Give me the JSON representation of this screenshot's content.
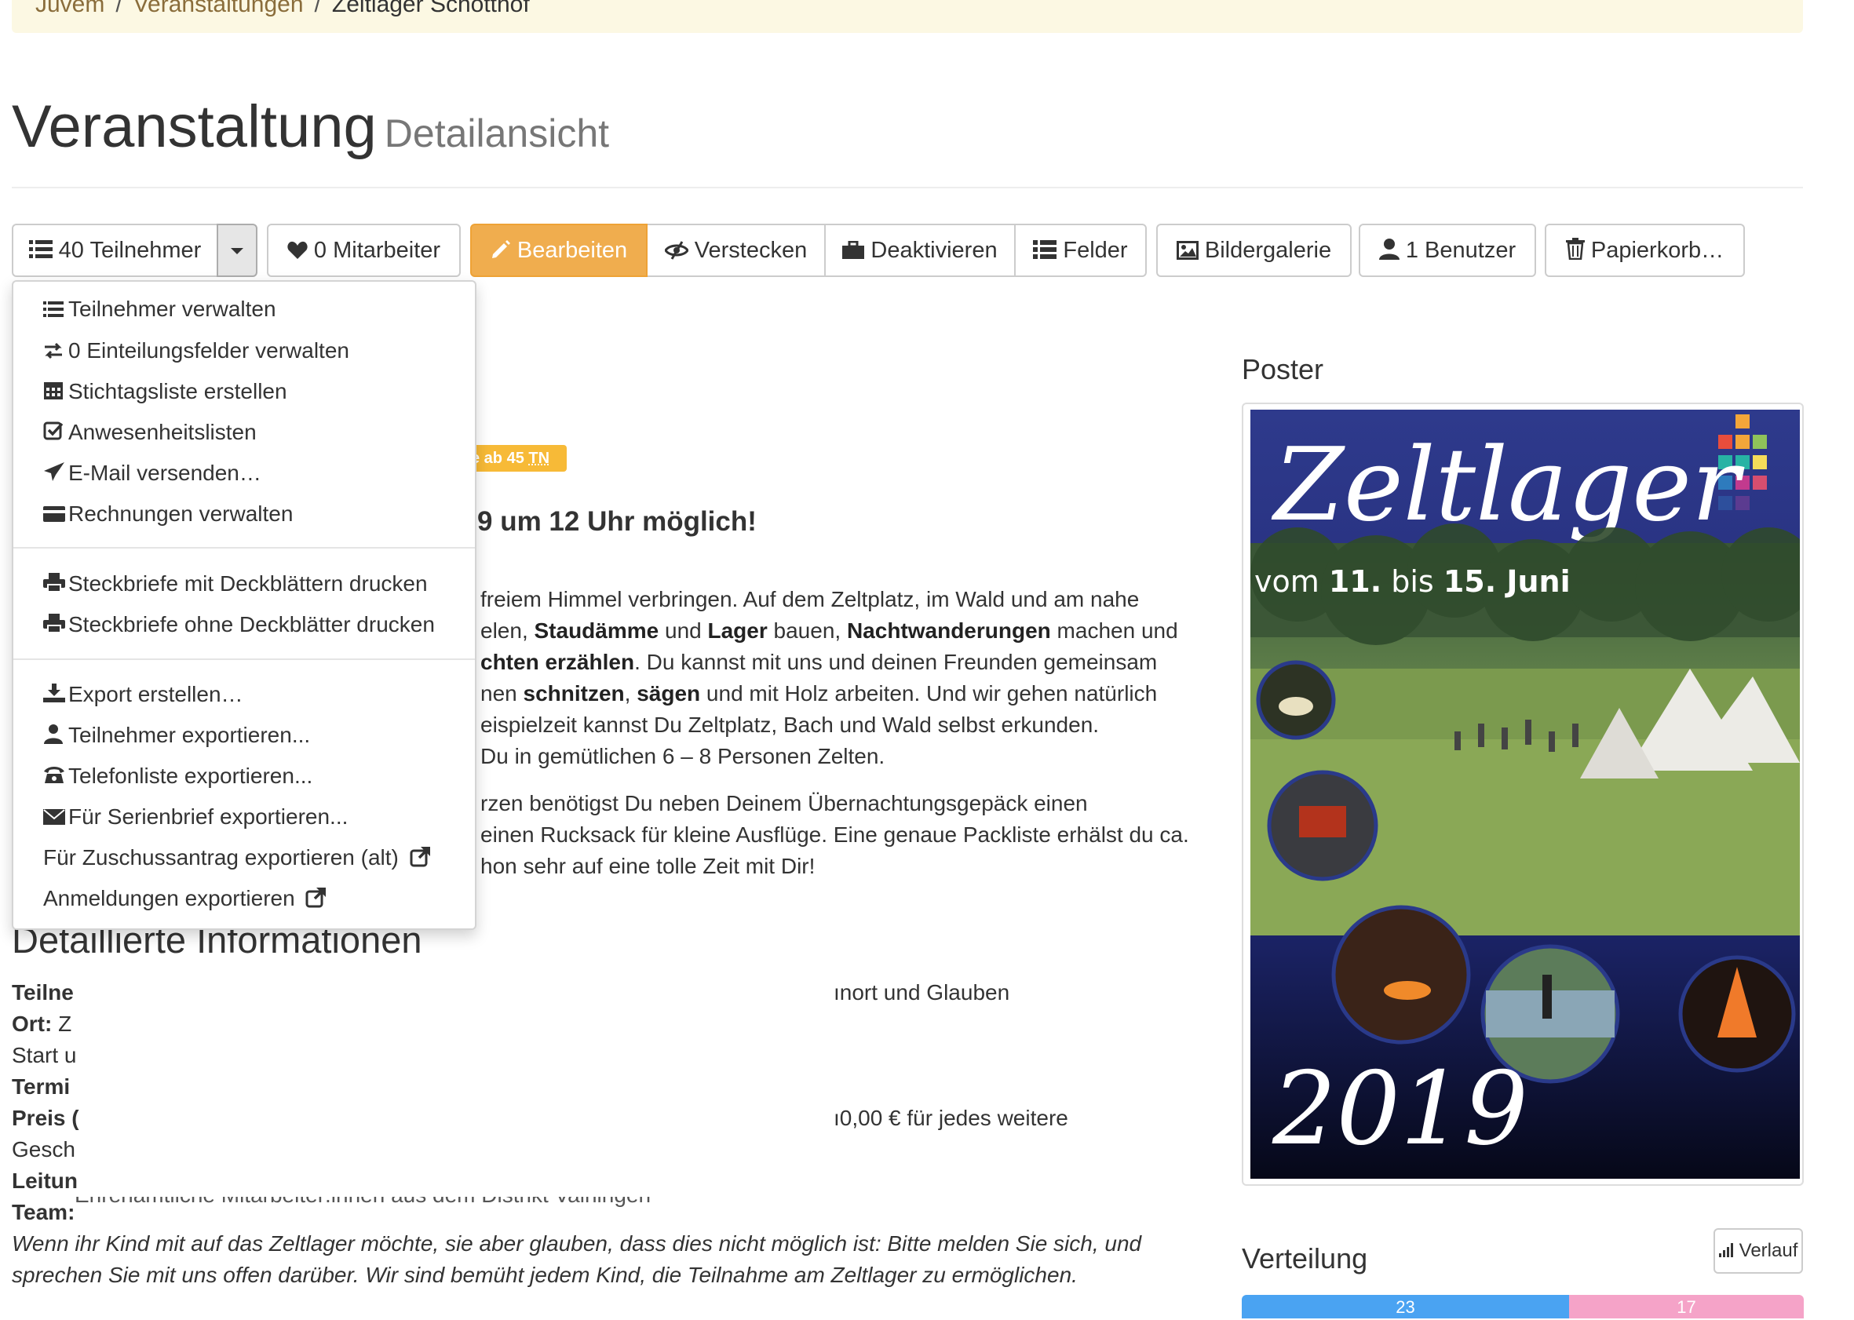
{
  "breadcrumb": [
    "Juvem",
    "Veranstaltungen",
    "Zeltlager Schotthof"
  ],
  "page": {
    "title": "Veranstaltung",
    "subtitle": "Detailansicht"
  },
  "toolbar": {
    "participants": "40 Teilnehmer",
    "employees": "0 Mitarbeiter",
    "edit": "Bearbeiten",
    "hide": "Verstecken",
    "deactivate": "Deaktivieren",
    "fields": "Felder",
    "gallery": "Bildergalerie",
    "users": "1 Benutzer",
    "trash": "Papierkorb…"
  },
  "dropdown": {
    "items": [
      "Teilnehmer verwalten",
      "0 Einteilungsfelder verwalten",
      "Stichtagsliste erstellen",
      "Anwesenheitslisten",
      "E-Mail versenden…",
      "Rechnungen verwalten",
      "Steckbriefe mit Deckblättern drucken",
      "Steckbriefe ohne Deckblätter drucken",
      "Export erstellen…",
      "Teilnehmer exportieren...",
      "Telefonliste exportieren...",
      "Für Serienbrief exportieren...",
      "Für Zuschussantrag exportieren (alt)",
      "Anmeldungen exportieren"
    ]
  },
  "badge": {
    "prefix": "e ab 45",
    "tn": "TN"
  },
  "announcement": "9 um 12 Uhr möglich!",
  "description": {
    "l1": "freiem Himmel verbringen. Auf dem Zeltplatz, im Wald und am nahe",
    "l2a": "elen, ",
    "l2b": "Staudämme",
    "l2c": " und ",
    "l2d": "Lager",
    "l2e": " bauen, ",
    "l2f": "Nachtwanderungen",
    "l2g": " machen und",
    "l3a": "chten erzählen",
    "l3b": ". Du kannst mit uns und deinen Freunden gemeinsam",
    "l4a": "nen ",
    "l4b": "schnitzen",
    "l4c": ", ",
    "l4d": "sägen",
    "l4e": " und mit Holz arbeiten. Und wir gehen natürlich",
    "l5": "eispielzeit kannst Du Zeltplatz, Bach und Wald selbst erkunden.",
    "l6": "Du in gemütlichen 6 – 8 Personen Zelten.",
    "l7": "rzen benötigst Du neben Deinem Übernachtungsgepäck einen",
    "l8": "einen Rucksack für kleine Ausflüge. Eine genaue Packliste erhälst du ca.",
    "l9": "hon sehr auf eine tolle Zeit mit Dir!"
  },
  "details": {
    "heading": "Detaillierte Informationen",
    "labels": [
      "Teilne",
      "Ort:",
      "Start u",
      "Termi",
      "Preis (",
      "Gesch",
      "Leitun",
      "Team:"
    ],
    "ort_value": "Z",
    "right1": "ınort und Glauben",
    "right2": "ı0,00 € für jedes weitere",
    "team_value": "Ehrenamtliche Mitarbeiter:innen aus dem Distrikt Vaihingen"
  },
  "note": "Wenn ihr Kind mit auf das Zeltlager möchte, sie aber glauben, dass dies nicht möglich ist: Bitte melden Sie sich, und sprechen Sie mit uns offen darüber. Wir sind bemüht jedem Kind, die Teilnahme am Zeltlager zu ermöglichen.",
  "poster": {
    "heading": "Poster",
    "script_title": "Zeltlager",
    "date_prefix": "vom ",
    "date_11": "11.",
    "date_mid": " bis ",
    "date_15": "15. Juni",
    "year": "2019"
  },
  "distribution": {
    "heading": "Verteilung",
    "button": "Verlauf",
    "male": "23",
    "female": "17",
    "colors": {
      "male": "#4aa3f2",
      "female": "#f5a3c8"
    }
  }
}
